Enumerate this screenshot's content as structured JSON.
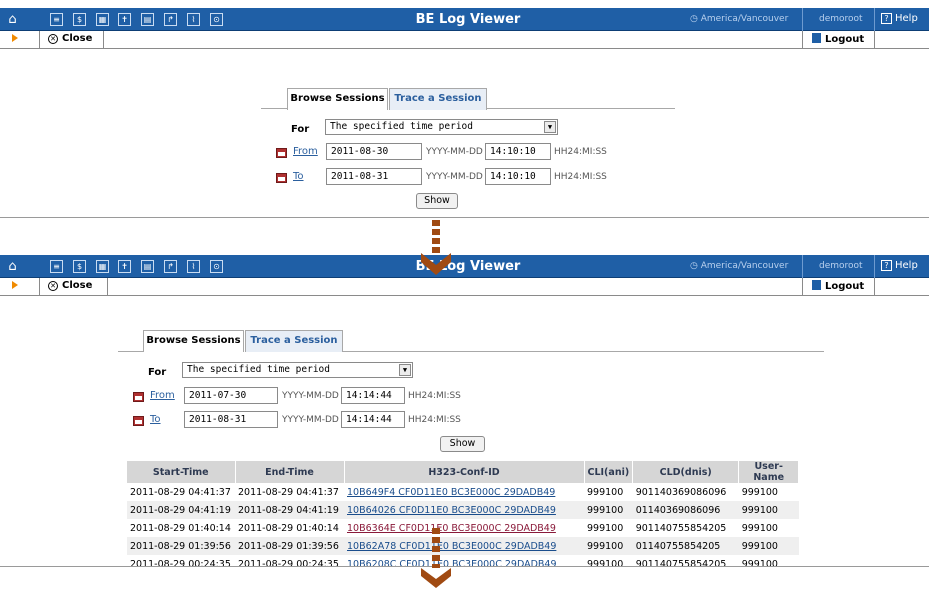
{
  "header": {
    "title": "BE Log Viewer",
    "timezone": "America/Vancouver",
    "user": "demoroot",
    "help": "Help"
  },
  "toolbar": {
    "close": "Close",
    "logout": "Logout"
  },
  "tabs": {
    "browse": "Browse Sessions",
    "trace": "Trace a Session"
  },
  "form": {
    "for_label": "For",
    "for_value": "The specified time period",
    "from_label": "From",
    "to_label": "To",
    "date_hint": "YYYY-MM-DD",
    "time_hint": "HH24:MI:SS",
    "show_button": "Show"
  },
  "screen1": {
    "from_date": "2011-08-30",
    "from_time": "14:10:10",
    "to_date": "2011-08-31",
    "to_time": "14:10:10"
  },
  "screen2": {
    "from_date": "2011-07-30",
    "from_time": "14:14:44",
    "to_date": "2011-08-31",
    "to_time": "14:14:44"
  },
  "table": {
    "columns": [
      "Start-Time",
      "End-Time",
      "H323-Conf-ID",
      "CLI(ani)",
      "CLD(dnis)",
      "User-Name"
    ],
    "rows": [
      [
        "2011-08-29 04:41:37",
        "2011-08-29 04:41:37",
        "10B649F4 CF0D11E0 BC3E000C 29DADB49",
        "999100",
        "901140369086096",
        "999100"
      ],
      [
        "2011-08-29 04:41:19",
        "2011-08-29 04:41:19",
        "10B64026 CF0D11E0 BC3E000C 29DADB49",
        "999100",
        "01140369086096",
        "999100"
      ],
      [
        "2011-08-29 01:40:14",
        "2011-08-29 01:40:14",
        "10B6364E CF0D11E0 BC3E000C 29DADB49",
        "999100",
        "901140755854205",
        "999100"
      ],
      [
        "2011-08-29 01:39:56",
        "2011-08-29 01:39:56",
        "10B62A78 CF0D11E0 BC3E000C 29DADB49",
        "999100",
        "01140755854205",
        "999100"
      ],
      [
        "2011-08-29 00:24:35",
        "2011-08-29 00:24:35",
        "10B6208C CF0D11E0 BC3E000C 29DADB49",
        "999100",
        "901140755854205",
        "999100"
      ]
    ]
  },
  "colors": {
    "header_bg": "#1f5fa6",
    "accent_link": "#2b5f9e",
    "flow_arrow": "#a04a12",
    "toolbar_arrow": "#f08a00"
  }
}
